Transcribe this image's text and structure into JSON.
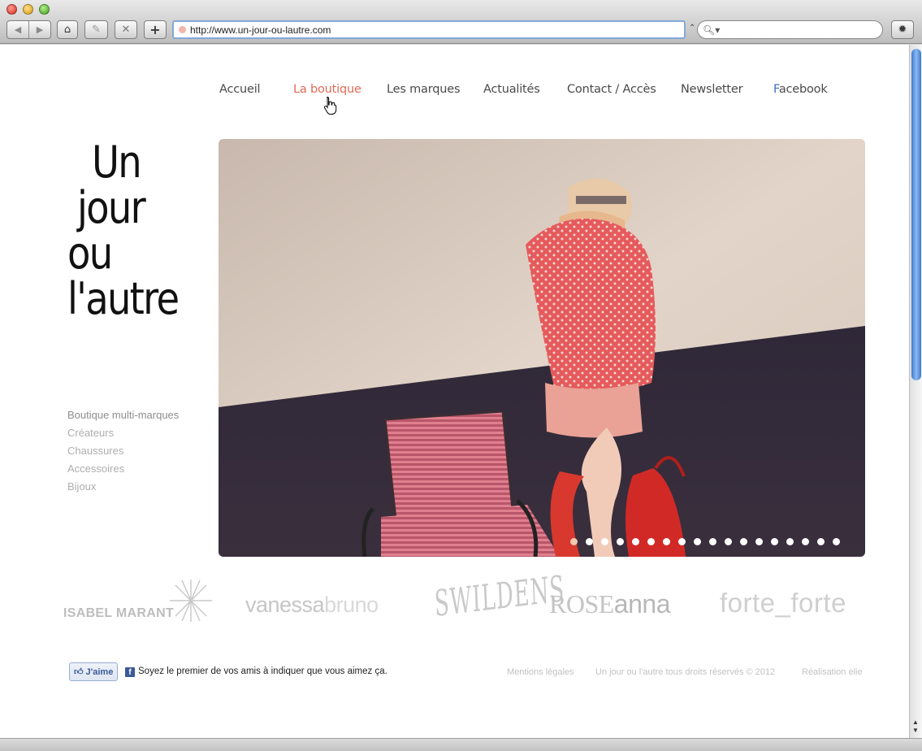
{
  "browser": {
    "url": "http://www.un-jour-ou-lautre.com",
    "search_placeholder": "",
    "nav_back_glyph": "◀",
    "nav_forward_glyph": "▶",
    "home_glyph": "⌂",
    "edit_glyph": "✎",
    "stop_glyph": "✕",
    "add_glyph": "+",
    "search_glyph": "🔍︎▾",
    "bug_glyph": "✹",
    "url_caret": "⌃"
  },
  "nav": {
    "items": [
      {
        "label": "Accueil"
      },
      {
        "label": "La boutique",
        "active": true
      },
      {
        "label": "Les marques"
      },
      {
        "label": "Actualités"
      },
      {
        "label": "Contact / Accès"
      },
      {
        "label": "Newsletter"
      }
    ],
    "facebook_first": "F",
    "facebook_rest": "acebook"
  },
  "logo": {
    "lines": [
      "Un",
      "jour",
      "ou",
      "l'autre"
    ]
  },
  "side_menu": {
    "items": [
      "Boutique multi-marques",
      "Créateurs",
      "Chaussures",
      "Accessoires",
      "Bijoux"
    ]
  },
  "hero": {
    "slide_count": 18,
    "active_slide": 1
  },
  "brands": {
    "isabel": "ISABEL MARANT",
    "vb_bold": "vanessa",
    "vb_light": "bruno",
    "swildens": "SWILDENS",
    "ra_rose": "ROSE",
    "ra_anna": "anna",
    "forte": "forte_forte"
  },
  "footer": {
    "like_label": "J'aime",
    "like_icon": "👍︎",
    "like_fb": "f",
    "like_text": "Soyez le premier de vos amis à indiquer que vous aimez ça.",
    "links": [
      "Mentions légales",
      "Un jour ou l'autre tous droits réservés © 2012",
      "Réalisation elie"
    ]
  },
  "colors": {
    "nav_active": "#e06b55",
    "facebook_blue": "#3b6ec1",
    "side_menu": "#aeaeae"
  }
}
